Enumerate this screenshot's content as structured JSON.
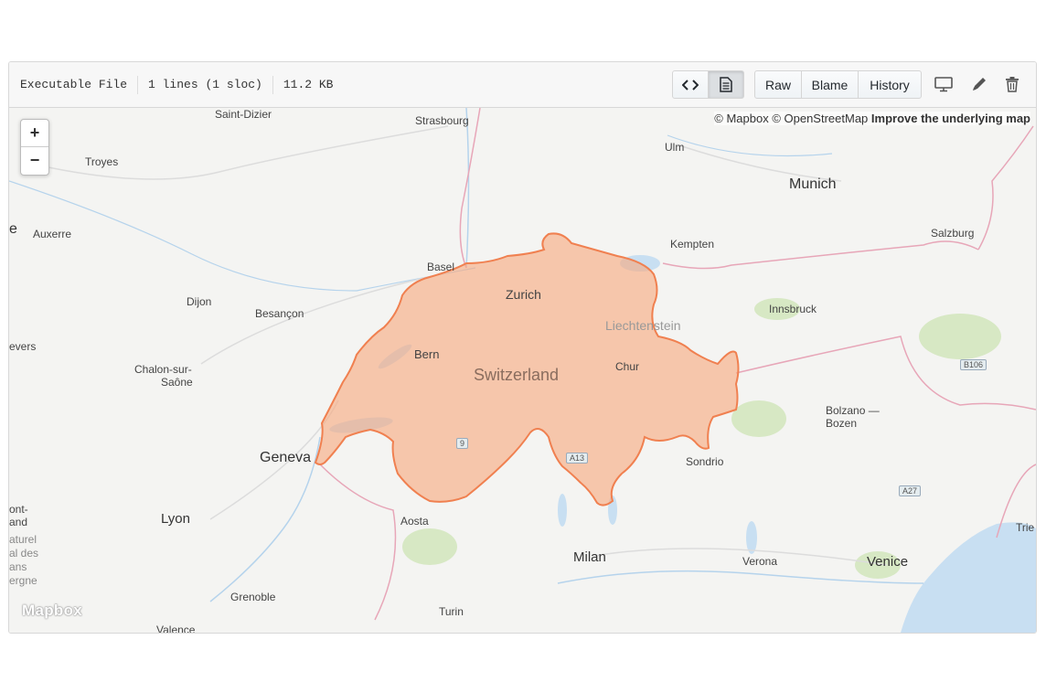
{
  "file_info": {
    "mode": "Executable File",
    "lines": "1 lines (1 sloc)",
    "size": "11.2 KB"
  },
  "toolbar": {
    "raw_label": "Raw",
    "blame_label": "Blame",
    "history_label": "History",
    "icons": [
      "code-icon",
      "file-render-icon",
      "desktop-icon",
      "pencil-icon",
      "trash-icon"
    ]
  },
  "map": {
    "zoom_in": "+",
    "zoom_out": "−",
    "attribution_prefix": "© Mapbox © OpenStreetMap ",
    "attribution_link": "Improve the underlying map",
    "logo": "Mapbox",
    "highlight_color": "#f7a980",
    "highlight_border": "#f08050",
    "labels": {
      "saint_dizier": "Saint-Dizier",
      "strasbourg": "Strasbourg",
      "ulm": "Ulm",
      "munich": "Munich",
      "troyes": "Troyes",
      "auxerre": "Auxerre",
      "basel": "Basel",
      "kempten": "Kempten",
      "salzburg": "Salzburg",
      "zurich": "Zurich",
      "dijon": "Dijon",
      "besancon": "Besançon",
      "liechtenstein": "Liechtenstein",
      "innsbruck": "Innsbruck",
      "nevers": "evers",
      "bern": "Bern",
      "switzerland": "Switzerland",
      "chur": "Chur",
      "chalon1": "Chalon-sur-",
      "chalon2": "Saône",
      "bolzano1": "Bolzano —",
      "bolzano2": "Bozen",
      "geneva": "Geneva",
      "sondrio": "Sondrio",
      "lyon": "Lyon",
      "aosta": "Aosta",
      "milan": "Milan",
      "verona": "Verona",
      "venice": "Venice",
      "grenoble": "Grenoble",
      "turin": "Turin",
      "valence": "Valence",
      "trieste": "Trie",
      "edge_e": "e",
      "mont1": "ont-",
      "mont2": "and",
      "parc1": "aturel",
      "parc2": "al des",
      "parc3": "ans",
      "parc4": "ergne",
      "road_9": "9",
      "road_a13": "A13",
      "road_a27": "A27",
      "road_b106": "B106"
    }
  }
}
